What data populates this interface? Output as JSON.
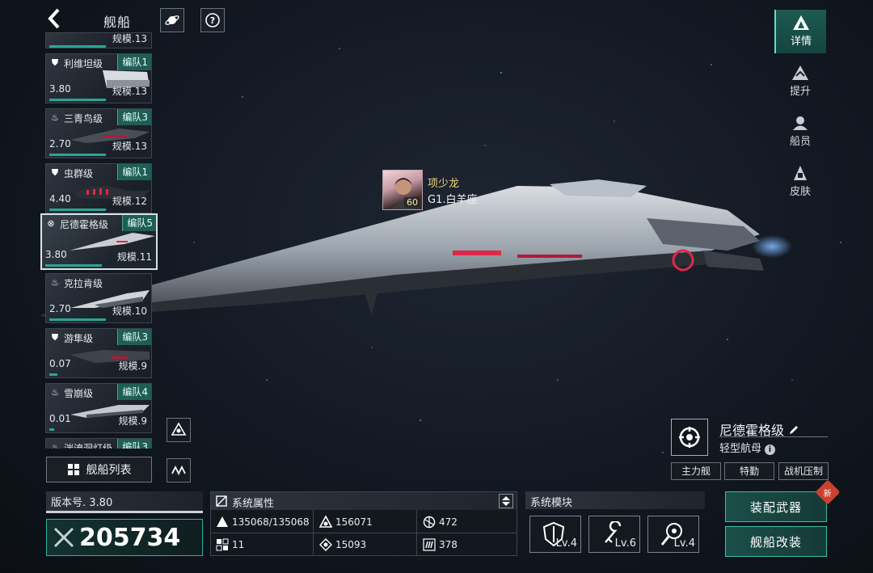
{
  "header": {
    "title": "舰船",
    "back_icon": "chevron-left-icon"
  },
  "ship_list": [
    {
      "name": "",
      "fleet": "",
      "score": "",
      "scale": "规模.13",
      "class_icon": "shield-icon",
      "partial": true
    },
    {
      "name": "利维坦级",
      "fleet": "编队1",
      "score": "3.80",
      "scale": "规模.13",
      "class_icon": "shield-icon"
    },
    {
      "name": "三青鸟级",
      "fleet": "编队3",
      "score": "2.70",
      "scale": "规模.13",
      "class_icon": "flame-icon"
    },
    {
      "name": "虫群级",
      "fleet": "编队1",
      "score": "4.40",
      "scale": "规模.12",
      "class_icon": "shield-icon"
    },
    {
      "name": "尼德霍格级",
      "fleet": "编队5",
      "score": "3.80",
      "scale": "规模.11",
      "class_icon": "crosshair-icon",
      "selected": true
    },
    {
      "name": "克拉肯级",
      "fleet": "",
      "score": "2.70",
      "scale": "规模.10",
      "class_icon": "flame-icon"
    },
    {
      "name": "游隼级",
      "fleet": "编队3",
      "score": "0.07",
      "scale": "规模.9",
      "class_icon": "shield-icon"
    },
    {
      "name": "雪崩级",
      "fleet": "编队4",
      "score": "0.01",
      "scale": "规模.9",
      "class_icon": "flame-icon"
    },
    {
      "name": "湍流洞灯级",
      "fleet": "编队3",
      "score": "",
      "scale": "",
      "class_icon": "flame-icon",
      "partial": true
    }
  ],
  "fleet_list_button": "舰船列表",
  "right_nav": [
    {
      "label": "详情",
      "active": true
    },
    {
      "label": "提升",
      "active": false
    },
    {
      "label": "船员",
      "active": false
    },
    {
      "label": "皮肤",
      "active": false
    }
  ],
  "captain": {
    "name": "项少龙",
    "title": "G1.白羊座",
    "level": "60"
  },
  "ship": {
    "name": "尼德霍格级",
    "type": "轻型航母",
    "tags": [
      "主力舰",
      "特勤",
      "战机压制"
    ]
  },
  "version": {
    "label": "版本号. 3.80",
    "power": "205734"
  },
  "system_attributes": {
    "title": "系统属性",
    "stats": [
      {
        "icon": "armor-icon",
        "value": "135068/135068"
      },
      {
        "icon": "hull-icon",
        "value": "156071"
      },
      {
        "icon": "engine-icon",
        "value": "472"
      },
      {
        "icon": "grid-icon",
        "value": "11"
      },
      {
        "icon": "target-icon",
        "value": "15093"
      },
      {
        "icon": "speed-icon",
        "value": "378"
      }
    ]
  },
  "system_modules": {
    "title": "系统模块",
    "modules": [
      {
        "icon": "shield-module-icon",
        "level": "Lv.4"
      },
      {
        "icon": "wrench-module-icon",
        "level": "Lv.6"
      },
      {
        "icon": "radar-module-icon",
        "level": "Lv.4"
      }
    ]
  },
  "actions": {
    "equip_weapons": "装配武器",
    "modify_ship": "舰船改装",
    "new_badge": "新"
  },
  "colors": {
    "accent": "#2aa596",
    "fleet_tag": "#1f5e55",
    "captain_name": "#f0d57a",
    "background": "#121821"
  }
}
